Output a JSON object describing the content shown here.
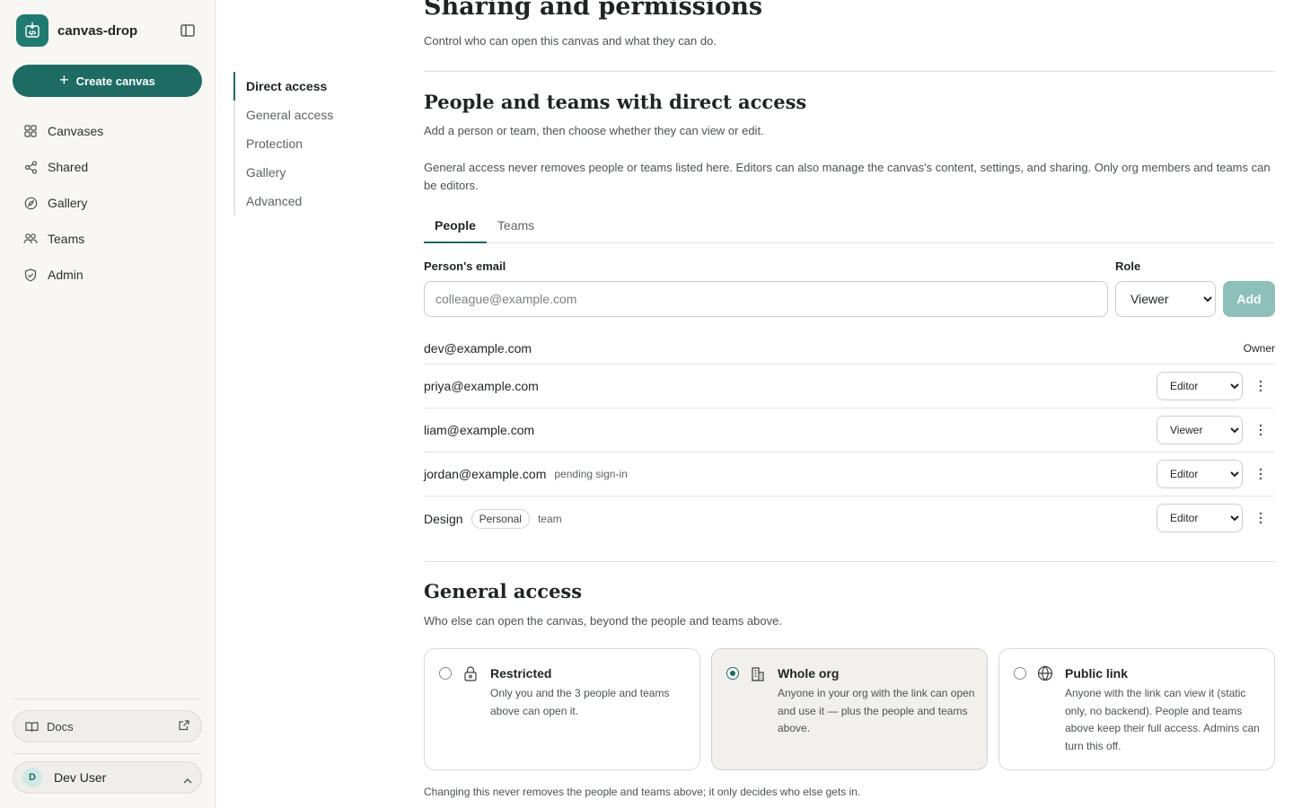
{
  "app": {
    "name": "canvas-drop",
    "create_label": "Create canvas",
    "brand_color": "#1d6b63"
  },
  "sidebar": {
    "items": [
      {
        "label": "Canvases",
        "icon": "grid-icon"
      },
      {
        "label": "Shared",
        "icon": "share-icon"
      },
      {
        "label": "Gallery",
        "icon": "compass-icon"
      },
      {
        "label": "Teams",
        "icon": "users-icon"
      },
      {
        "label": "Admin",
        "icon": "shield-icon"
      }
    ],
    "docs_label": "Docs",
    "user": {
      "initial": "D",
      "name": "Dev User"
    }
  },
  "subnav": {
    "items": [
      "Direct access",
      "General access",
      "Protection",
      "Gallery",
      "Advanced"
    ],
    "active": "Direct access"
  },
  "page": {
    "title": "Sharing and permissions",
    "subtitle": "Control who can open this canvas and what they can do."
  },
  "direct": {
    "title": "People and teams with direct access",
    "subtitle": "Add a person or team, then choose whether they can view or edit.",
    "info": "General access never removes people or teams listed here. Editors can also manage the canvas's content, settings, and sharing. Only org members and teams can be editors.",
    "tabs": [
      "People",
      "Teams"
    ],
    "email_label": "Person's email",
    "email_placeholder": "colleague@example.com",
    "role_label": "Role",
    "role_value": "Viewer",
    "add_label": "Add",
    "owner": {
      "email": "dev@example.com",
      "role": "Owner"
    },
    "members": [
      {
        "name": "priya@example.com",
        "note": "",
        "role": "Editor"
      },
      {
        "name": "liam@example.com",
        "note": "",
        "role": "Viewer"
      },
      {
        "name": "jordan@example.com",
        "note": "pending sign-in",
        "role": "Editor"
      },
      {
        "name": "Design",
        "pill": "Personal",
        "note": "team",
        "role": "Editor"
      }
    ]
  },
  "general": {
    "title": "General access",
    "subtitle": "Who else can open the canvas, beyond the people and teams above.",
    "options": [
      {
        "title": "Restricted",
        "desc": "Only you and the 3 people and teams above can open it.",
        "icon": "lock-icon",
        "selected": false
      },
      {
        "title": "Whole org",
        "desc": "Anyone in your org with the link can open and use it — plus the people and teams above.",
        "icon": "building-icon",
        "selected": true
      },
      {
        "title": "Public link",
        "desc": "Anyone with the link can view it (static only, no backend). People and teams above keep their full access. Admins can turn this off.",
        "icon": "globe-icon",
        "selected": false
      }
    ],
    "footnote": "Changing this never removes the people and teams above; it only decides who else gets in."
  }
}
